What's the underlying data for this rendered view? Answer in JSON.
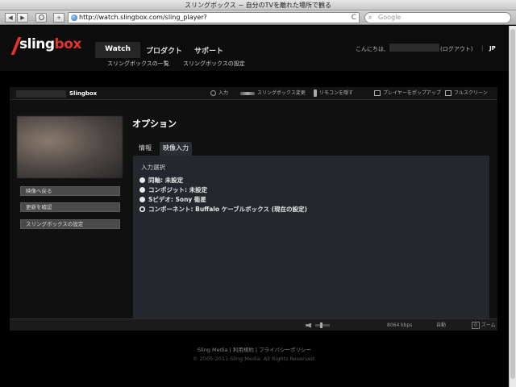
{
  "browser": {
    "title": "スリングボックス − 自分のTVを離れた場所で観る",
    "url": "http://watch.slingbox.com/sling_player?",
    "search_placeholder": "Google",
    "back": "◀",
    "forward": "▶",
    "add": "+",
    "reload": "C"
  },
  "logo": {
    "text_a": "sling",
    "text_b": "box"
  },
  "nav": {
    "watch": "Watch",
    "products": "プロダクト",
    "support": "サポート",
    "sub_list": "スリングボックスの一覧",
    "sub_settings": "スリングボックスの設定"
  },
  "account": {
    "greeting": "こんにちは,",
    "logout": "(ログアウト)",
    "separator": "|",
    "lang": "JP"
  },
  "player": {
    "device_name": "Slingbox",
    "tools": {
      "input": "入力",
      "change_box": "スリングボックス変更",
      "remote": "リモコンを隠す",
      "popup": "プレイヤーをポップアップ",
      "fullscreen": "フルスクリーン"
    },
    "side_buttons": [
      "映像へ戻る",
      "更新を確認",
      "スリングボックスの設定"
    ],
    "options_title": "オプション",
    "tabs": [
      "情報",
      "映像入力"
    ],
    "panel_label": "入力選択",
    "inputs": [
      "同軸: 未設定",
      "コンポジット: 未設定",
      "Sビデオ: Sony 衛星",
      "コンポーネント: Buffalo ケーブルボックス (現在の設定)"
    ],
    "selected_input_index": 3,
    "bitrate": "8064 kbps",
    "mode": "自動",
    "zoom_label": "ズーム",
    "zoom_value": "0"
  },
  "footer": {
    "links": "Sling Media | 利用規約 | プライバシーポリシー",
    "copyright": "© 2005-2011 Sling Media. All Rights Reserved."
  },
  "colors": {
    "brand_red": "#e5322d",
    "panel": "#24272d"
  }
}
